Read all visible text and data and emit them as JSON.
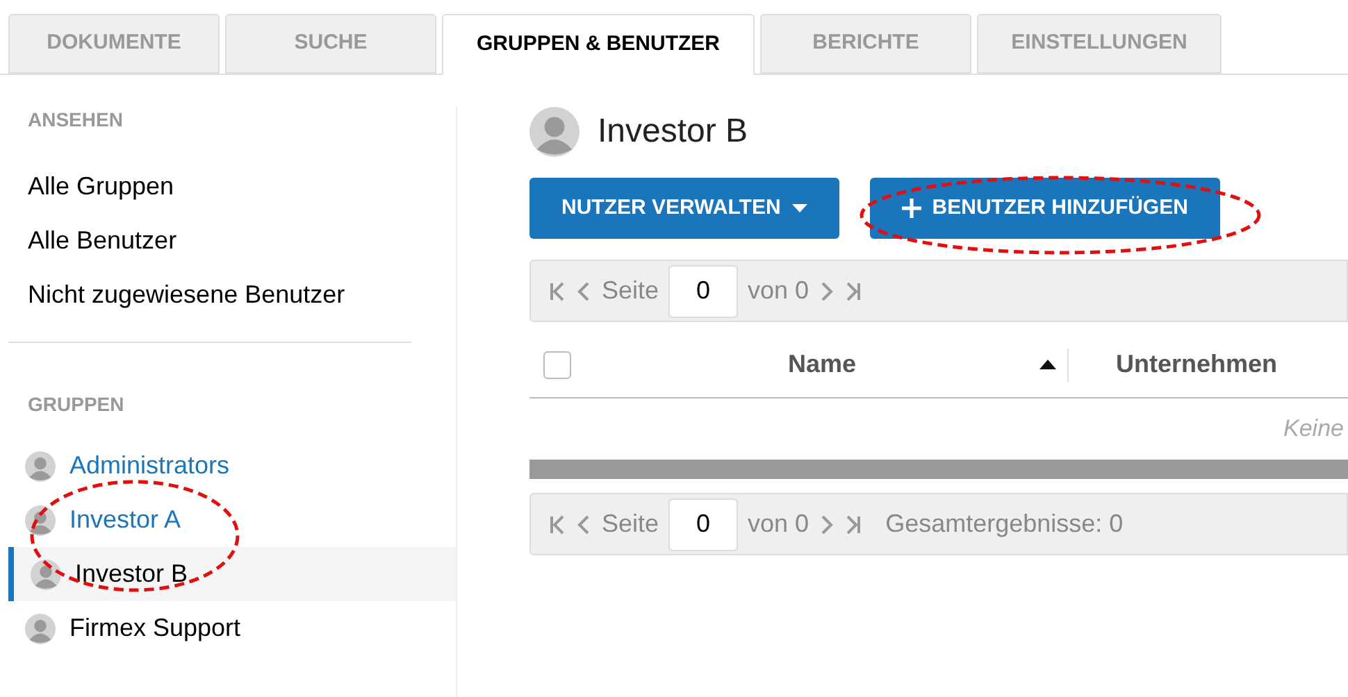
{
  "tabs": [
    {
      "label": "DOKUMENTE",
      "selected": false
    },
    {
      "label": "SUCHE",
      "selected": false
    },
    {
      "label": "GRUPPEN & BENUTZER",
      "selected": true
    },
    {
      "label": "BERICHTE",
      "selected": false
    },
    {
      "label": "EINSTELLUNGEN",
      "selected": false
    }
  ],
  "sidebar": {
    "view_heading": "ANSEHEN",
    "view_items": [
      "Alle Gruppen",
      "Alle Benutzer",
      "Nicht zugewiesene Benutzer"
    ],
    "groups_heading": "GRUPPEN",
    "groups": [
      {
        "label": "Administrators",
        "linked": true,
        "selected": false
      },
      {
        "label": "Investor A",
        "linked": true,
        "selected": false
      },
      {
        "label": "Investor B",
        "linked": false,
        "selected": true
      },
      {
        "label": "Firmex Support",
        "linked": false,
        "selected": false
      }
    ]
  },
  "main": {
    "title": "Investor B",
    "buttons": [
      {
        "label": "NUTZER VERWALTEN",
        "kind": "dropdown"
      },
      {
        "label": "BENUTZER HINZUFÜGEN",
        "kind": "add"
      }
    ],
    "top_pager": {
      "page_label": "Seite",
      "page": "0",
      "of": "von 0"
    },
    "table": {
      "columns": [
        {
          "label": "Name",
          "sorted": true
        },
        {
          "label": "Unternehmen",
          "sorted": false
        }
      ],
      "checked": false,
      "empty_text": "Keine"
    },
    "bottom_pager": {
      "page_label": "Seite",
      "page": "0",
      "of": "von 0",
      "total": "Gesamtergebnisse: 0"
    }
  }
}
